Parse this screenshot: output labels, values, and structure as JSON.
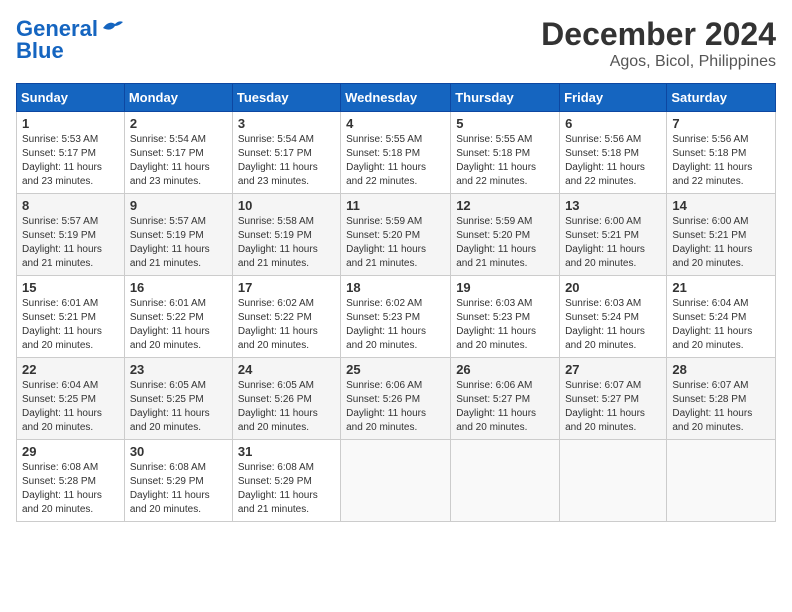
{
  "logo": {
    "line1": "General",
    "line2": "Blue"
  },
  "title": "December 2024",
  "subtitle": "Agos, Bicol, Philippines",
  "days_of_week": [
    "Sunday",
    "Monday",
    "Tuesday",
    "Wednesday",
    "Thursday",
    "Friday",
    "Saturday"
  ],
  "weeks": [
    [
      {
        "day": "1",
        "info": "Sunrise: 5:53 AM\nSunset: 5:17 PM\nDaylight: 11 hours\nand 23 minutes."
      },
      {
        "day": "2",
        "info": "Sunrise: 5:54 AM\nSunset: 5:17 PM\nDaylight: 11 hours\nand 23 minutes."
      },
      {
        "day": "3",
        "info": "Sunrise: 5:54 AM\nSunset: 5:17 PM\nDaylight: 11 hours\nand 23 minutes."
      },
      {
        "day": "4",
        "info": "Sunrise: 5:55 AM\nSunset: 5:18 PM\nDaylight: 11 hours\nand 22 minutes."
      },
      {
        "day": "5",
        "info": "Sunrise: 5:55 AM\nSunset: 5:18 PM\nDaylight: 11 hours\nand 22 minutes."
      },
      {
        "day": "6",
        "info": "Sunrise: 5:56 AM\nSunset: 5:18 PM\nDaylight: 11 hours\nand 22 minutes."
      },
      {
        "day": "7",
        "info": "Sunrise: 5:56 AM\nSunset: 5:18 PM\nDaylight: 11 hours\nand 22 minutes."
      }
    ],
    [
      {
        "day": "8",
        "info": "Sunrise: 5:57 AM\nSunset: 5:19 PM\nDaylight: 11 hours\nand 21 minutes."
      },
      {
        "day": "9",
        "info": "Sunrise: 5:57 AM\nSunset: 5:19 PM\nDaylight: 11 hours\nand 21 minutes."
      },
      {
        "day": "10",
        "info": "Sunrise: 5:58 AM\nSunset: 5:19 PM\nDaylight: 11 hours\nand 21 minutes."
      },
      {
        "day": "11",
        "info": "Sunrise: 5:59 AM\nSunset: 5:20 PM\nDaylight: 11 hours\nand 21 minutes."
      },
      {
        "day": "12",
        "info": "Sunrise: 5:59 AM\nSunset: 5:20 PM\nDaylight: 11 hours\nand 21 minutes."
      },
      {
        "day": "13",
        "info": "Sunrise: 6:00 AM\nSunset: 5:21 PM\nDaylight: 11 hours\nand 20 minutes."
      },
      {
        "day": "14",
        "info": "Sunrise: 6:00 AM\nSunset: 5:21 PM\nDaylight: 11 hours\nand 20 minutes."
      }
    ],
    [
      {
        "day": "15",
        "info": "Sunrise: 6:01 AM\nSunset: 5:21 PM\nDaylight: 11 hours\nand 20 minutes."
      },
      {
        "day": "16",
        "info": "Sunrise: 6:01 AM\nSunset: 5:22 PM\nDaylight: 11 hours\nand 20 minutes."
      },
      {
        "day": "17",
        "info": "Sunrise: 6:02 AM\nSunset: 5:22 PM\nDaylight: 11 hours\nand 20 minutes."
      },
      {
        "day": "18",
        "info": "Sunrise: 6:02 AM\nSunset: 5:23 PM\nDaylight: 11 hours\nand 20 minutes."
      },
      {
        "day": "19",
        "info": "Sunrise: 6:03 AM\nSunset: 5:23 PM\nDaylight: 11 hours\nand 20 minutes."
      },
      {
        "day": "20",
        "info": "Sunrise: 6:03 AM\nSunset: 5:24 PM\nDaylight: 11 hours\nand 20 minutes."
      },
      {
        "day": "21",
        "info": "Sunrise: 6:04 AM\nSunset: 5:24 PM\nDaylight: 11 hours\nand 20 minutes."
      }
    ],
    [
      {
        "day": "22",
        "info": "Sunrise: 6:04 AM\nSunset: 5:25 PM\nDaylight: 11 hours\nand 20 minutes."
      },
      {
        "day": "23",
        "info": "Sunrise: 6:05 AM\nSunset: 5:25 PM\nDaylight: 11 hours\nand 20 minutes."
      },
      {
        "day": "24",
        "info": "Sunrise: 6:05 AM\nSunset: 5:26 PM\nDaylight: 11 hours\nand 20 minutes."
      },
      {
        "day": "25",
        "info": "Sunrise: 6:06 AM\nSunset: 5:26 PM\nDaylight: 11 hours\nand 20 minutes."
      },
      {
        "day": "26",
        "info": "Sunrise: 6:06 AM\nSunset: 5:27 PM\nDaylight: 11 hours\nand 20 minutes."
      },
      {
        "day": "27",
        "info": "Sunrise: 6:07 AM\nSunset: 5:27 PM\nDaylight: 11 hours\nand 20 minutes."
      },
      {
        "day": "28",
        "info": "Sunrise: 6:07 AM\nSunset: 5:28 PM\nDaylight: 11 hours\nand 20 minutes."
      }
    ],
    [
      {
        "day": "29",
        "info": "Sunrise: 6:08 AM\nSunset: 5:28 PM\nDaylight: 11 hours\nand 20 minutes."
      },
      {
        "day": "30",
        "info": "Sunrise: 6:08 AM\nSunset: 5:29 PM\nDaylight: 11 hours\nand 20 minutes."
      },
      {
        "day": "31",
        "info": "Sunrise: 6:08 AM\nSunset: 5:29 PM\nDaylight: 11 hours\nand 21 minutes."
      },
      {
        "day": "",
        "info": ""
      },
      {
        "day": "",
        "info": ""
      },
      {
        "day": "",
        "info": ""
      },
      {
        "day": "",
        "info": ""
      }
    ]
  ]
}
